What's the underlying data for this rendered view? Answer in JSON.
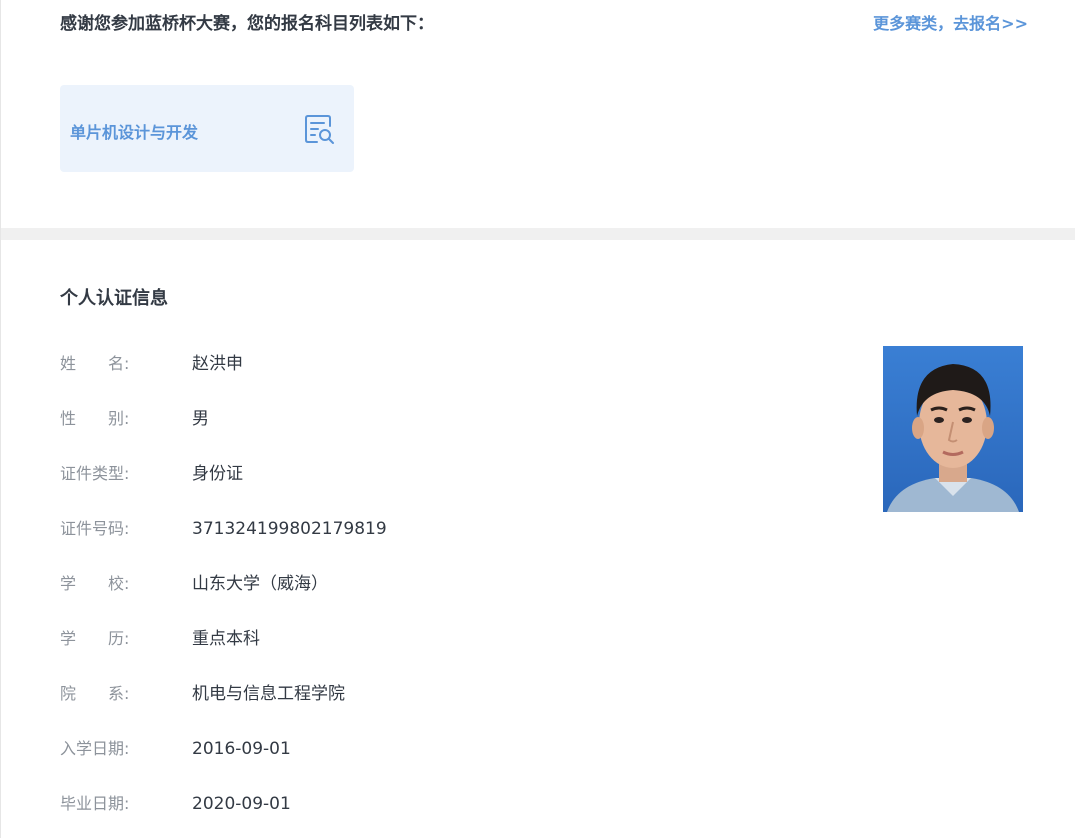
{
  "registration": {
    "title": "感谢您参加蓝桥杯大赛，您的报名科目列表如下：",
    "more_link": "更多赛类，去报名>>",
    "subjects": [
      {
        "name": "单片机设计与开发",
        "icon": "document-search-icon"
      }
    ]
  },
  "personal_info": {
    "heading": "个人认证信息",
    "fields": [
      {
        "label": "姓　　名:",
        "value": "赵洪申"
      },
      {
        "label": "性　　别:",
        "value": "男"
      },
      {
        "label": "证件类型:",
        "value": "身份证"
      },
      {
        "label": "证件号码:",
        "value": "371324199802179819"
      },
      {
        "label": "学　　校:",
        "value": "山东大学（威海）"
      },
      {
        "label": "学　　历:",
        "value": "重点本科"
      },
      {
        "label": "院　　系:",
        "value": "机电与信息工程学院"
      },
      {
        "label": "入学日期:",
        "value": "2016-09-01"
      },
      {
        "label": "毕业日期:",
        "value": "2020-09-01"
      }
    ],
    "photo": "id-photo"
  },
  "colors": {
    "accent": "#5b95d9",
    "card_bg": "#ecf3fc",
    "heading_text": "#333a44",
    "label_text": "#8d939b",
    "divider": "#f0f0f0",
    "photo_bg": "#2e6fc4"
  }
}
